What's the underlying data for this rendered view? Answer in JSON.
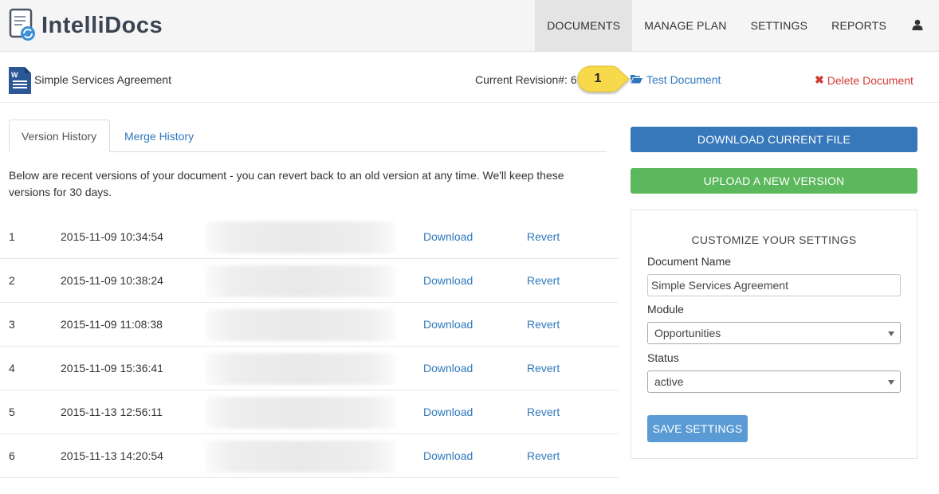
{
  "app": {
    "logo_text": "IntelliDocs"
  },
  "nav": {
    "items": [
      {
        "label": "DOCUMENTS",
        "active": true
      },
      {
        "label": "MANAGE PLAN"
      },
      {
        "label": "SETTINGS"
      },
      {
        "label": "REPORTS"
      }
    ],
    "user_icon": "user-icon"
  },
  "document": {
    "name": "Simple Services Agreement",
    "icon": "word-document-icon",
    "revision_label": "Current Revision#: 6",
    "callout_number": "1",
    "test_link": "Test Document",
    "test_icon": "folder-open-icon",
    "delete_link": "Delete Document",
    "delete_icon": "close-icon"
  },
  "tabs": [
    {
      "label": "Version History",
      "active": true
    },
    {
      "label": "Merge History"
    }
  ],
  "intro": "Below are recent versions of your document - you can revert back to an old version at any time. We'll keep these versions for 30 days.",
  "versions": [
    {
      "num": "1",
      "date": "2015-11-09 10:34:54",
      "download": "Download",
      "revert": "Revert"
    },
    {
      "num": "2",
      "date": "2015-11-09 10:38:24",
      "download": "Download",
      "revert": "Revert"
    },
    {
      "num": "3",
      "date": "2015-11-09 11:08:38",
      "download": "Download",
      "revert": "Revert"
    },
    {
      "num": "4",
      "date": "2015-11-09 15:36:41",
      "download": "Download",
      "revert": "Revert"
    },
    {
      "num": "5",
      "date": "2015-11-13 12:56:11",
      "download": "Download",
      "revert": "Revert"
    },
    {
      "num": "6",
      "date": "2015-11-13 14:20:54",
      "download": "Download",
      "revert": "Revert"
    }
  ],
  "actions": {
    "download_current": "DOWNLOAD CURRENT FILE",
    "upload_new": "UPLOAD A NEW VERSION"
  },
  "settings": {
    "title": "CUSTOMIZE YOUR SETTINGS",
    "doc_name_label": "Document Name",
    "doc_name_value": "Simple Services Agreement",
    "module_label": "Module",
    "module_value": "Opportunities",
    "status_label": "Status",
    "status_value": "active",
    "save_label": "SAVE SETTINGS"
  },
  "colors": {
    "link": "#2f78bd",
    "primary": "#3778bb",
    "success": "#5cb85c",
    "danger": "#d33b36",
    "callout": "#f7d94c"
  }
}
